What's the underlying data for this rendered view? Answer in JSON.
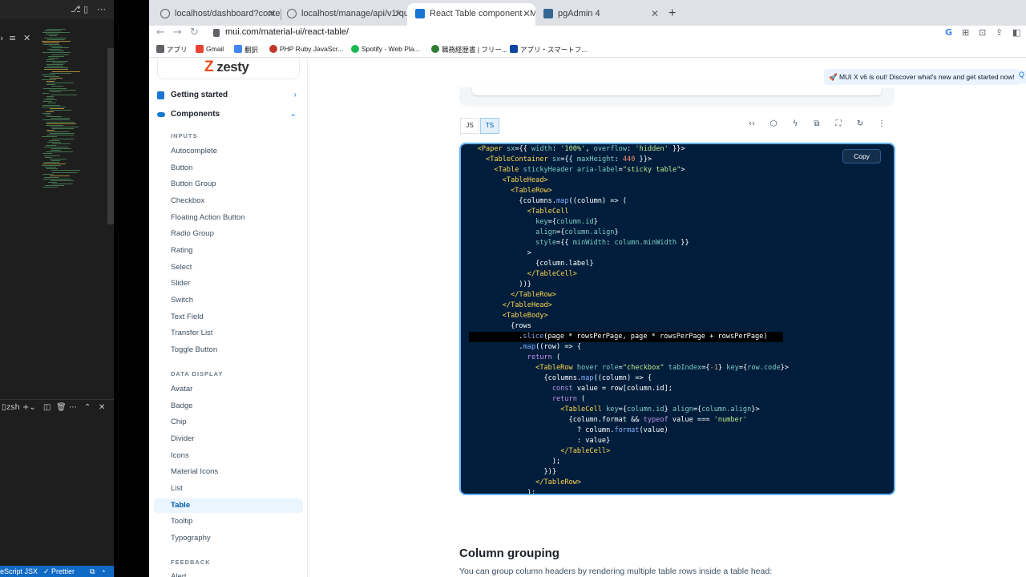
{
  "editor": {
    "terminal_label": "zsh",
    "status_left": "eScript JSX",
    "status_right": "✓ Prettier"
  },
  "browser": {
    "tabs": [
      {
        "title": "localhost/dashboard?contents",
        "active": false
      },
      {
        "title": "localhost/manage/api/v1/quest",
        "active": false
      },
      {
        "title": "React Table component - Mate",
        "active": true
      },
      {
        "title": "pgAdmin 4",
        "active": false
      }
    ],
    "url": "mui.com/material-ui/react-table/",
    "bookmarks": [
      "アプリ",
      "Gmail",
      "翻訳",
      "PHP Ruby JavaScr...",
      "Spotify - Web Pla...",
      "職務経歴書 | フリー...",
      "アプリ・スマートフ..."
    ]
  },
  "sidebar": {
    "top_items": [
      {
        "label": "Getting started"
      },
      {
        "label": "Components"
      }
    ],
    "sections": [
      {
        "title": "INPUTS",
        "items": [
          "Autocomplete",
          "Button",
          "Button Group",
          "Checkbox",
          "Floating Action Button",
          "Radio Group",
          "Rating",
          "Select",
          "Slider",
          "Switch",
          "Text Field",
          "Transfer List",
          "Toggle Button"
        ]
      },
      {
        "title": "DATA DISPLAY",
        "items": [
          "Avatar",
          "Badge",
          "Chip",
          "Divider",
          "Icons",
          "Material Icons",
          "List",
          "Table",
          "Tooltip",
          "Typography"
        ]
      },
      {
        "title": "FEEDBACK",
        "items": [
          "Alert"
        ]
      }
    ],
    "active_item": "Table"
  },
  "announcement": "🚀 MUI X v6 is out! Discover what's new and get started now!",
  "demo": {
    "copy_label": "Copy",
    "toggle_labels": [
      "JS",
      "TS"
    ]
  },
  "content": {
    "heading": "Column grouping",
    "paragraph": "You can group column headers by rendering multiple table rows inside a table head:"
  },
  "colors": {
    "code_bg": "#001e3c",
    "accent": "#1976d2",
    "active_bg": "#ebf5ff"
  }
}
